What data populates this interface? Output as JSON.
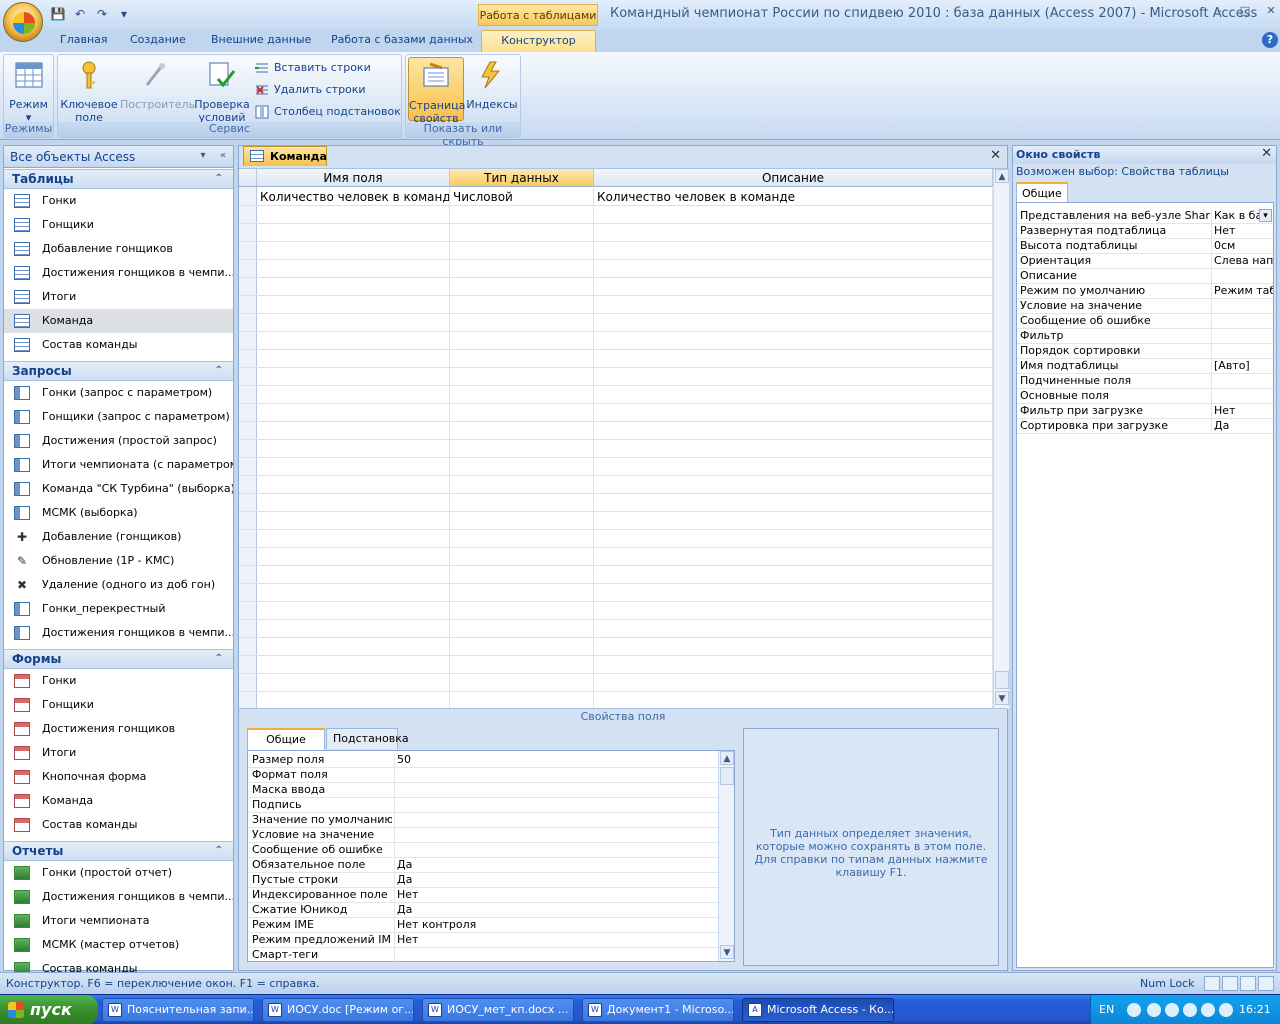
{
  "window": {
    "context_tab_title": "Работа с таблицами",
    "title": "Командный чемпионат России по спидвею 2010 : база данных (Access 2007) - Microsoft Access",
    "minimize": "–",
    "maximize": "□",
    "close": "✕"
  },
  "qat": {
    "save": "💾",
    "undo": "↶",
    "redo": "↷",
    "customize": "▾"
  },
  "tabs": [
    "Главная",
    "Создание",
    "Внешние данные",
    "Работа с базами данных",
    "Конструктор"
  ],
  "help": "?",
  "ribbon": {
    "view_label": "Режим",
    "view_arrow": "▾",
    "group_views": "Режимы",
    "primary_key": "Ключевое поле",
    "builder": "Построитель",
    "test_rules": "Проверка условий",
    "insert_rows": "Вставить строки",
    "delete_rows": "Удалить строки",
    "lookup_column": "Столбец подстановок",
    "group_tools": "Сервис",
    "property_sheet": "Страница свойств",
    "indexes": "Индексы",
    "group_show_hide": "Показать или скрыть"
  },
  "nav": {
    "header": "Все объекты Access",
    "header_dropdown": "▾",
    "header_collapse": "«",
    "collapse_glyph": "«",
    "sections": [
      {
        "title": "Таблицы",
        "type": "table",
        "items": [
          "Гонки",
          "Гонщики",
          "Добавление гонщиков",
          "Достижения гонщиков в чемпи...",
          "Итоги",
          "Команда",
          "Состав команды"
        ]
      },
      {
        "title": "Запросы",
        "type": "query",
        "items": [
          "Гонки (запрос с параметром)",
          "Гонщики (запрос с параметром)",
          "Достижения (простой запрос)",
          "Итоги чемпионата (с параметром)",
          "Команда \"СК Турбина\" (выборка)",
          "МСМК (выборка)",
          "Добавление (гонщиков)",
          "Обновление (1Р - КМС)",
          "Удаление (одного из доб гон)",
          "Гонки_перекрестный",
          "Достижения гонщиков в чемпи..."
        ]
      },
      {
        "title": "Формы",
        "type": "form",
        "items": [
          "Гонки",
          "Гонщики",
          "Достижения гонщиков",
          "Итоги",
          "Кнопочная форма",
          "Команда",
          "Состав команды"
        ]
      },
      {
        "title": "Отчеты",
        "type": "report",
        "items": [
          "Гонки (простой отчет)",
          "Достижения гонщиков в чемпи...",
          "Итоги чемпионата",
          "МСМК (мастер отчетов)",
          "Состав команды"
        ]
      }
    ],
    "selected": "Команда",
    "chevron": "⌃"
  },
  "document": {
    "tab": "Команда",
    "close": "✕",
    "columns": [
      "Имя поля",
      "Тип данных",
      "Описание"
    ],
    "rows": [
      [
        "Количество человек в команде",
        "Числовой",
        "Количество человек в команде"
      ]
    ],
    "scroll_up": "▲",
    "scroll_down": "▼",
    "field_props_label": "Свойства поля",
    "fp_tabs": [
      "Общие",
      "Подстановка"
    ],
    "field_props": [
      [
        "Размер поля",
        "50"
      ],
      [
        "Формат поля",
        ""
      ],
      [
        "Маска ввода",
        ""
      ],
      [
        "Подпись",
        ""
      ],
      [
        "Значение по умолчанию",
        ""
      ],
      [
        "Условие на значение",
        ""
      ],
      [
        "Сообщение об ошибке",
        ""
      ],
      [
        "Обязательное поле",
        "Да"
      ],
      [
        "Пустые строки",
        "Да"
      ],
      [
        "Индексированное поле",
        "Нет"
      ],
      [
        "Сжатие Юникод",
        "Да"
      ],
      [
        "Режим IME",
        "Нет контроля"
      ],
      [
        "Режим предложений IME",
        "Нет"
      ],
      [
        "Смарт-теги",
        ""
      ]
    ],
    "help_text": "Тип данных определяет значения, которые можно сохранять в этом поле.  Для справки по типам данных нажмите клавишу F1."
  },
  "property_sheet": {
    "title": "Окно свойств",
    "close": "✕",
    "selection": "Возможен выбор:  Свойства таблицы",
    "tab": "Общие",
    "dropdown": "▾",
    "rows": [
      [
        "Представления на веб-узле SharePo",
        "Как в ба"
      ],
      [
        "Развернутая подтаблица",
        "Нет"
      ],
      [
        "Высота подтаблицы",
        "0см"
      ],
      [
        "Ориентация",
        "Слева напр"
      ],
      [
        "Описание",
        ""
      ],
      [
        "Режим по умолчанию",
        "Режим табл"
      ],
      [
        "Условие на значение",
        ""
      ],
      [
        "Сообщение об ошибке",
        ""
      ],
      [
        "Фильтр",
        ""
      ],
      [
        "Порядок сортировки",
        ""
      ],
      [
        "Имя подтаблицы",
        "[Авто]"
      ],
      [
        "Подчиненные поля",
        ""
      ],
      [
        "Основные поля",
        ""
      ],
      [
        "Фильтр при загрузке",
        "Нет"
      ],
      [
        "Сортировка при загрузке",
        "Да"
      ]
    ]
  },
  "status": {
    "text": "Конструктор.  F6 = переключение окон.  F1 = справка.",
    "numlock": "Num Lock"
  },
  "taskbar": {
    "start": "пуск",
    "word_icon": "W",
    "access_icon": "A",
    "tasks": [
      "Пояснительная запи...",
      "ИОСУ.doc [Режим ог...",
      "ИОСУ_мет_кп.docx ...",
      "Документ1 - Microso...",
      "Microsoft Access - Ко..."
    ],
    "active_task": 4,
    "lang": "EN",
    "clock": "16:21"
  }
}
